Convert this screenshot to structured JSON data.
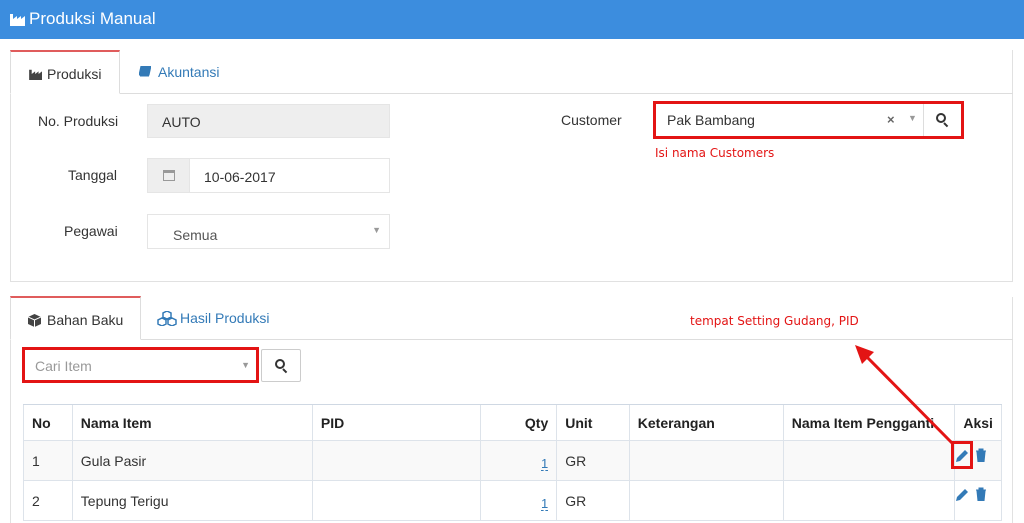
{
  "header": {
    "title": "Produksi Manual"
  },
  "tabs_top": [
    {
      "label": "Produksi",
      "active": true
    },
    {
      "label": "Akuntansi",
      "active": false
    }
  ],
  "form": {
    "no_produksi_label": "No. Produksi",
    "no_produksi_value": "AUTO",
    "tanggal_label": "Tanggal",
    "tanggal_value": "10-06-2017",
    "pegawai_label": "Pegawai",
    "pegawai_value": "Semua",
    "customer_label": "Customer",
    "customer_value": "Pak Bambang"
  },
  "annotations": {
    "customer_note": "Isi nama Customers",
    "setting_note": "tempat Setting Gudang, PID"
  },
  "tabs_bottom": [
    {
      "label": "Bahan Baku",
      "active": true
    },
    {
      "label": "Hasil Produksi",
      "active": false
    }
  ],
  "search": {
    "placeholder": "Cari Item"
  },
  "table": {
    "columns": [
      "No",
      "Nama Item",
      "PID",
      "Qty",
      "Unit",
      "Keterangan",
      "Nama Item Pengganti",
      "Aksi"
    ],
    "rows": [
      {
        "no": "1",
        "nama_item": "Gula Pasir",
        "pid": "",
        "qty": "1",
        "unit": "GR",
        "keterangan": "",
        "pengganti": ""
      },
      {
        "no": "2",
        "nama_item": "Tepung Terigu",
        "pid": "",
        "qty": "1",
        "unit": "GR",
        "keterangan": "",
        "pengganti": ""
      }
    ]
  },
  "colors": {
    "header_bg": "#3c8dde",
    "accent_red": "#e31414",
    "link_blue": "#337ab7",
    "tab_top_border": "#e05c5c"
  },
  "icons": [
    "factory-icon",
    "book-icon",
    "calendar-icon",
    "clear-icon",
    "chevron-down-icon",
    "search-icon",
    "cube-icon",
    "cubes-icon",
    "pencil-icon",
    "trash-icon",
    "arrow-icon"
  ]
}
